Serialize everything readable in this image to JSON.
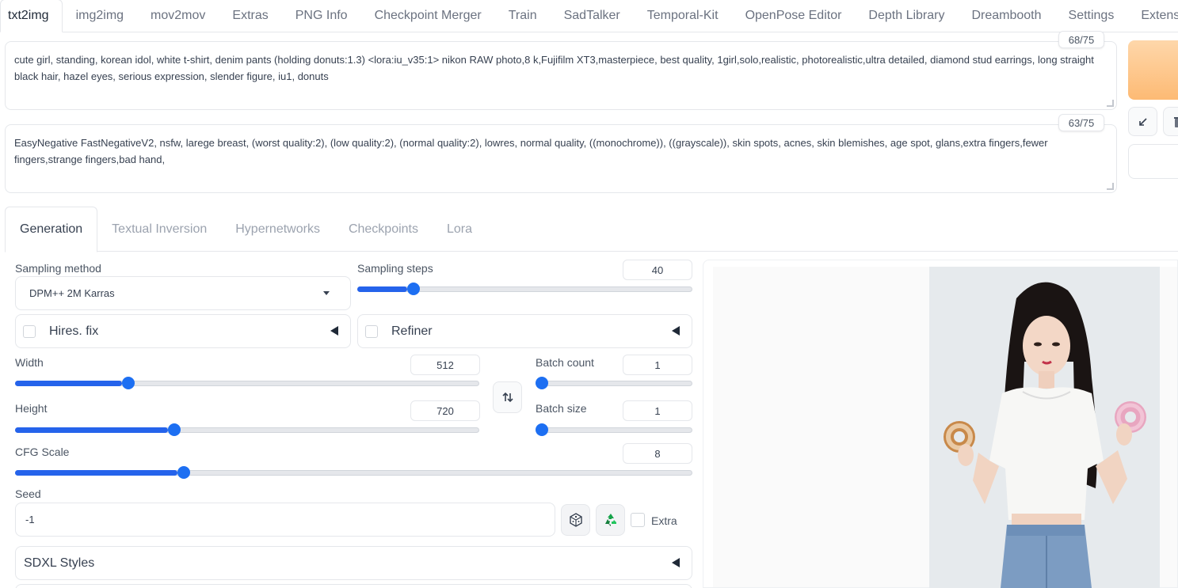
{
  "top_tabs": [
    "txt2img",
    "img2img",
    "mov2mov",
    "Extras",
    "PNG Info",
    "Checkpoint Merger",
    "Train",
    "SadTalker",
    "Temporal-Kit",
    "OpenPose Editor",
    "Depth Library",
    "Dreambooth",
    "Settings",
    "Extens"
  ],
  "prompt": {
    "text": "cute girl, standing, korean idol, white t-shirt, denim pants (holding donuts:1.3) <lora:iu_v35:1> nikon RAW photo,8 k,Fujifilm XT3,masterpiece, best quality, 1girl,solo,realistic, photorealistic,ultra detailed, diamond stud earrings, long straight black hair, hazel eyes, serious expression, slender figure, iu1, donuts",
    "counter": "68/75"
  },
  "negative_prompt": {
    "text": "EasyNegative FastNegativeV2, nsfw, larege breast, (worst quality:2), (low quality:2), (normal quality:2), lowres, normal quality, ((monochrome)), ((grayscale)), skin spots, acnes, skin blemishes, age spot, glans,extra fingers,fewer fingers,strange fingers,bad hand,",
    "counter": "63/75"
  },
  "sub_tabs": [
    "Generation",
    "Textual Inversion",
    "Hypernetworks",
    "Checkpoints",
    "Lora"
  ],
  "sampling_method": {
    "label": "Sampling method",
    "value": "DPM++ 2M Karras"
  },
  "sampling_steps": {
    "label": "Sampling steps",
    "value": "40",
    "fraction": 0.15
  },
  "hires_fix": {
    "label": "Hires. fix"
  },
  "refiner": {
    "label": "Refiner"
  },
  "width": {
    "label": "Width",
    "value": "512",
    "fraction": 0.23
  },
  "height": {
    "label": "Height",
    "value": "720",
    "fraction": 0.33
  },
  "batch_count": {
    "label": "Batch count",
    "value": "1",
    "fraction": 0.0
  },
  "batch_size": {
    "label": "Batch size",
    "value": "1",
    "fraction": 0.0
  },
  "cfg_scale": {
    "label": "CFG Scale",
    "value": "8",
    "fraction": 0.24
  },
  "seed": {
    "label": "Seed",
    "value": "-1"
  },
  "extra": {
    "label": "Extra"
  },
  "sdxl_styles": {
    "label": "SDXL Styles"
  },
  "icons": {
    "swap": "swap-vertical-icon",
    "dice": "dice-icon",
    "recycle": "recycle-icon",
    "send": "arrow-icon",
    "trash": "trash-icon"
  },
  "colors": {
    "accent": "#2563eb",
    "generate": "#fdba74"
  }
}
